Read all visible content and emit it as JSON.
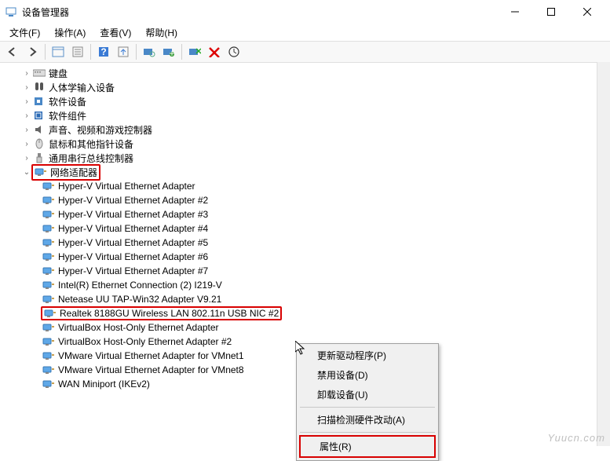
{
  "window": {
    "title": "设备管理器"
  },
  "menu": {
    "file": "文件(F)",
    "action": "操作(A)",
    "view": "查看(V)",
    "help": "帮助(H)"
  },
  "tree": {
    "items": [
      {
        "ind": 1,
        "exp": "›",
        "icon": "keyboard",
        "label": "键盘"
      },
      {
        "ind": 1,
        "exp": "›",
        "icon": "hid",
        "label": "人体学输入设备"
      },
      {
        "ind": 1,
        "exp": "›",
        "icon": "software",
        "label": "软件设备"
      },
      {
        "ind": 1,
        "exp": "›",
        "icon": "component",
        "label": "软件组件"
      },
      {
        "ind": 1,
        "exp": "›",
        "icon": "audio",
        "label": "声音、视频和游戏控制器"
      },
      {
        "ind": 1,
        "exp": "›",
        "icon": "mouse",
        "label": "鼠标和其他指针设备"
      },
      {
        "ind": 1,
        "exp": "›",
        "icon": "usb",
        "label": "通用串行总线控制器"
      },
      {
        "ind": 1,
        "exp": "⌄",
        "icon": "net",
        "label": "网络适配器",
        "red": true
      },
      {
        "ind": 2,
        "icon": "net",
        "label": "Hyper-V Virtual Ethernet Adapter"
      },
      {
        "ind": 2,
        "icon": "net",
        "label": "Hyper-V Virtual Ethernet Adapter #2"
      },
      {
        "ind": 2,
        "icon": "net",
        "label": "Hyper-V Virtual Ethernet Adapter #3"
      },
      {
        "ind": 2,
        "icon": "net",
        "label": "Hyper-V Virtual Ethernet Adapter #4"
      },
      {
        "ind": 2,
        "icon": "net",
        "label": "Hyper-V Virtual Ethernet Adapter #5"
      },
      {
        "ind": 2,
        "icon": "net",
        "label": "Hyper-V Virtual Ethernet Adapter #6"
      },
      {
        "ind": 2,
        "icon": "net",
        "label": "Hyper-V Virtual Ethernet Adapter #7"
      },
      {
        "ind": 2,
        "icon": "net",
        "label": "Intel(R) Ethernet Connection (2) I219-V"
      },
      {
        "ind": 2,
        "icon": "net",
        "label": "Netease UU TAP-Win32 Adapter V9.21"
      },
      {
        "ind": 2,
        "icon": "net",
        "label": "Realtek 8188GU Wireless LAN 802.11n USB NIC #2",
        "red": true
      },
      {
        "ind": 2,
        "icon": "net",
        "label": "VirtualBox Host-Only Ethernet Adapter"
      },
      {
        "ind": 2,
        "icon": "net",
        "label": "VirtualBox Host-Only Ethernet Adapter #2"
      },
      {
        "ind": 2,
        "icon": "net",
        "label": "VMware Virtual Ethernet Adapter for VMnet1"
      },
      {
        "ind": 2,
        "icon": "net",
        "label": "VMware Virtual Ethernet Adapter for VMnet8"
      },
      {
        "ind": 2,
        "icon": "net",
        "label": "WAN Miniport (IKEv2)"
      }
    ]
  },
  "ctx": {
    "update": "更新驱动程序(P)",
    "disable": "禁用设备(D)",
    "uninstall": "卸载设备(U)",
    "scan": "扫描检测硬件改动(A)",
    "props": "属性(R)"
  },
  "watermark": "Yuucn.com"
}
